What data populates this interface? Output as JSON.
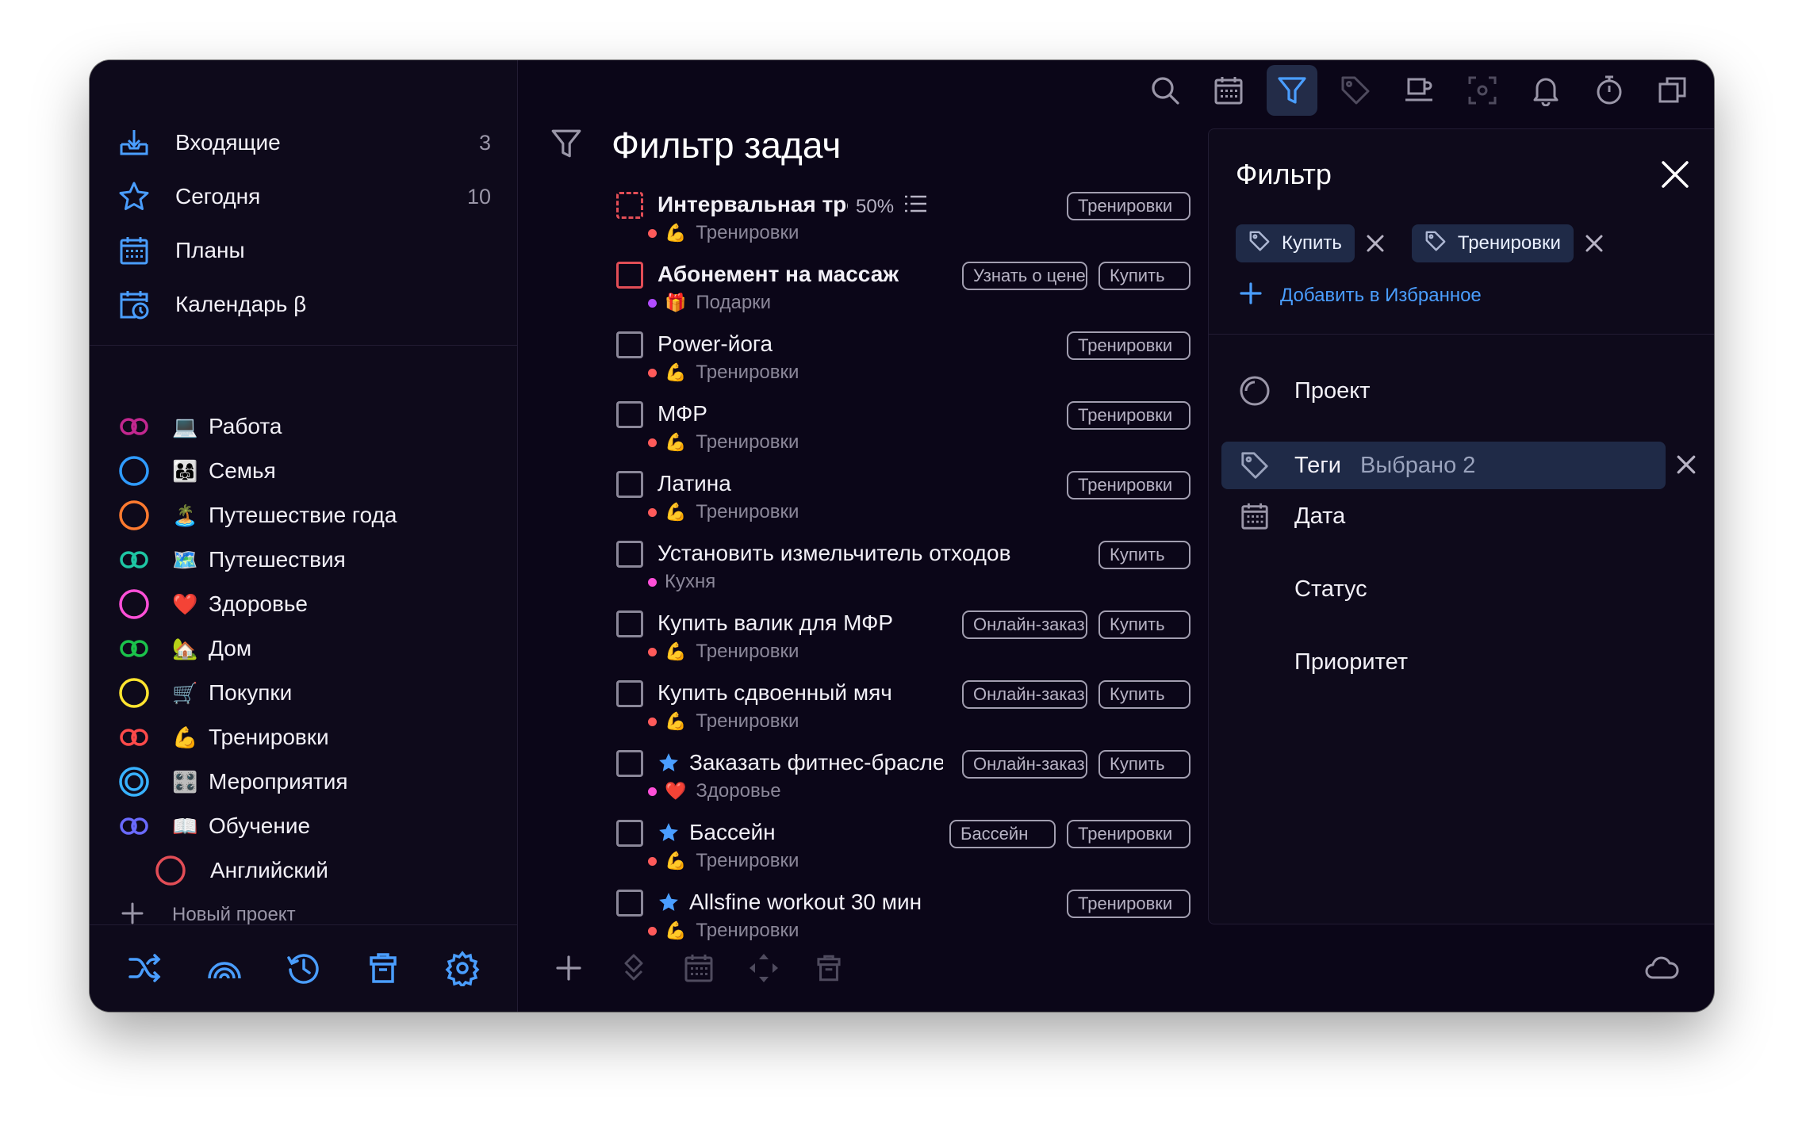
{
  "colors": {
    "accent": "#4a9eff",
    "bg": "#0b0618",
    "sidebar": "#0e0a1b",
    "selected": "#1f2a47",
    "red": "#e24d56"
  },
  "sidebar": {
    "nav": [
      {
        "icon": "inbox-icon",
        "label": "Входящие",
        "count": "3"
      },
      {
        "icon": "star-icon",
        "label": "Сегодня",
        "count": "10"
      },
      {
        "icon": "calendar-grid-icon",
        "label": "Планы",
        "count": ""
      },
      {
        "icon": "calendar-clock-icon",
        "label": "Календарь β",
        "count": ""
      }
    ],
    "projects": [
      {
        "icon": "infinity-icon",
        "color": "#c2278f",
        "emoji": "💻",
        "label": "Работа"
      },
      {
        "icon": "circle-icon",
        "color": "#2f9bff",
        "emoji": "👨‍👩‍👧",
        "label": "Семья"
      },
      {
        "icon": "circle-icon",
        "color": "#ff7a2f",
        "emoji": "🏝️",
        "label": "Путешествие года"
      },
      {
        "icon": "infinity-icon",
        "color": "#1ec6a4",
        "emoji": "🗺️",
        "label": "Путешествия"
      },
      {
        "icon": "circle-icon",
        "color": "#ff4fd8",
        "emoji": "❤️",
        "label": "Здоровье"
      },
      {
        "icon": "infinity-icon",
        "color": "#1bc24b",
        "emoji": "🏡",
        "label": "Дом"
      },
      {
        "icon": "circle-icon",
        "color": "#ffe42f",
        "emoji": "🛒",
        "label": "Покупки"
      },
      {
        "icon": "infinity-icon",
        "color": "#ff4a4a",
        "emoji": "💪",
        "label": "Тренировки"
      },
      {
        "icon": "double-circle-icon",
        "color": "#38b2ff",
        "emoji": "🎛️",
        "label": "Мероприятия"
      },
      {
        "icon": "infinity-icon",
        "color": "#6a6aff",
        "emoji": "📖",
        "label": "Обучение"
      }
    ],
    "subproject": {
      "icon": "circle-icon",
      "color": "#e24d56",
      "label": "Английский"
    },
    "new_project": "Новый проект",
    "bottom_icons": [
      "shuffle-icon",
      "rainbow-icon",
      "history-icon",
      "trash-icon",
      "settings-icon"
    ]
  },
  "toolbar": {
    "icons": [
      "search-icon",
      "calendar-icon",
      "filter-icon",
      "tag-icon",
      "coffee-icon",
      "focus-icon",
      "bell-icon",
      "timer-icon",
      "windows-icon"
    ],
    "active": "filter-icon"
  },
  "main": {
    "title": "Фильтр задач",
    "tasks": [
      {
        "title": "Интервальная тренировка",
        "bold": true,
        "checkbox": "dashed",
        "progress": "50%",
        "meta_dot": "#ff5a5a",
        "meta_emoji": "💪",
        "meta": "Тренировки",
        "chips": [
          "Тренировки"
        ]
      },
      {
        "title": "Абонемент на массаж",
        "bold": true,
        "checkbox": "red",
        "meta_dot": "#b14bff",
        "meta_emoji": "🎁",
        "meta": "Подарки",
        "chips": [
          "Узнать о цене",
          "Купить"
        ]
      },
      {
        "title": "Power-йога",
        "checkbox": "normal",
        "meta_dot": "#ff5a5a",
        "meta_emoji": "💪",
        "meta": "Тренировки",
        "chips": [
          "Тренировки"
        ]
      },
      {
        "title": "МФР",
        "checkbox": "normal",
        "meta_dot": "#ff5a5a",
        "meta_emoji": "💪",
        "meta": "Тренировки",
        "chips": [
          "Тренировки"
        ]
      },
      {
        "title": "Латина",
        "checkbox": "normal",
        "meta_dot": "#ff5a5a",
        "meta_emoji": "💪",
        "meta": "Тренировки",
        "chips": [
          "Тренировки"
        ]
      },
      {
        "title": "Установить измельчитель отходов",
        "checkbox": "normal",
        "meta_dot": "#ff4fd8",
        "meta_emoji": "",
        "meta": "Кухня",
        "chips": [
          "Купить"
        ]
      },
      {
        "title": "Купить валик для МФР",
        "checkbox": "normal",
        "meta_dot": "#ff5a5a",
        "meta_emoji": "💪",
        "meta": "Тренировки",
        "chips": [
          "Онлайн-заказ",
          "Купить"
        ]
      },
      {
        "title": "Купить сдвоенный мяч",
        "checkbox": "normal",
        "meta_dot": "#ff5a5a",
        "meta_emoji": "💪",
        "meta": "Тренировки",
        "chips": [
          "Онлайн-заказ",
          "Купить"
        ]
      },
      {
        "title": "Заказать фитнес-браслет",
        "star": true,
        "checkbox": "normal",
        "meta_dot": "#ff4fd8",
        "meta_emoji": "❤️",
        "meta": "Здоровье",
        "chips": [
          "Онлайн-заказ",
          "Купить"
        ]
      },
      {
        "title": "Бассейн",
        "star": true,
        "checkbox": "normal",
        "meta_dot": "#ff5a5a",
        "meta_emoji": "💪",
        "meta": "Тренировки",
        "chips": [
          "Бассейн",
          "Тренировки"
        ]
      },
      {
        "title": "Allsfine workout 30 мин",
        "star": true,
        "checkbox": "normal",
        "meta_dot": "#ff5a5a",
        "meta_emoji": "💪",
        "meta": "Тренировки",
        "chips": [
          "Тренировки"
        ]
      }
    ],
    "bottom_icons": [
      "plus-icon",
      "move-icon",
      "calendar-icon",
      "arrows-icon",
      "trash-icon"
    ],
    "cloud_icon": "cloud-icon"
  },
  "filter_panel": {
    "title": "Фильтр",
    "tags": [
      "Купить",
      "Тренировки"
    ],
    "add_favorite": "Добавить в Избранное",
    "rows": [
      {
        "icon": "project-icon",
        "label": "Проект",
        "value": "",
        "selected": false
      },
      {
        "icon": "tag-icon",
        "label": "Теги",
        "value": "Выбрано 2",
        "selected": true
      },
      {
        "icon": "calendar-icon",
        "label": "Дата",
        "value": "",
        "selected": false
      },
      {
        "icon": "",
        "label": "Статус",
        "value": "",
        "selected": false
      },
      {
        "icon": "",
        "label": "Приоритет",
        "value": "",
        "selected": false
      }
    ]
  }
}
